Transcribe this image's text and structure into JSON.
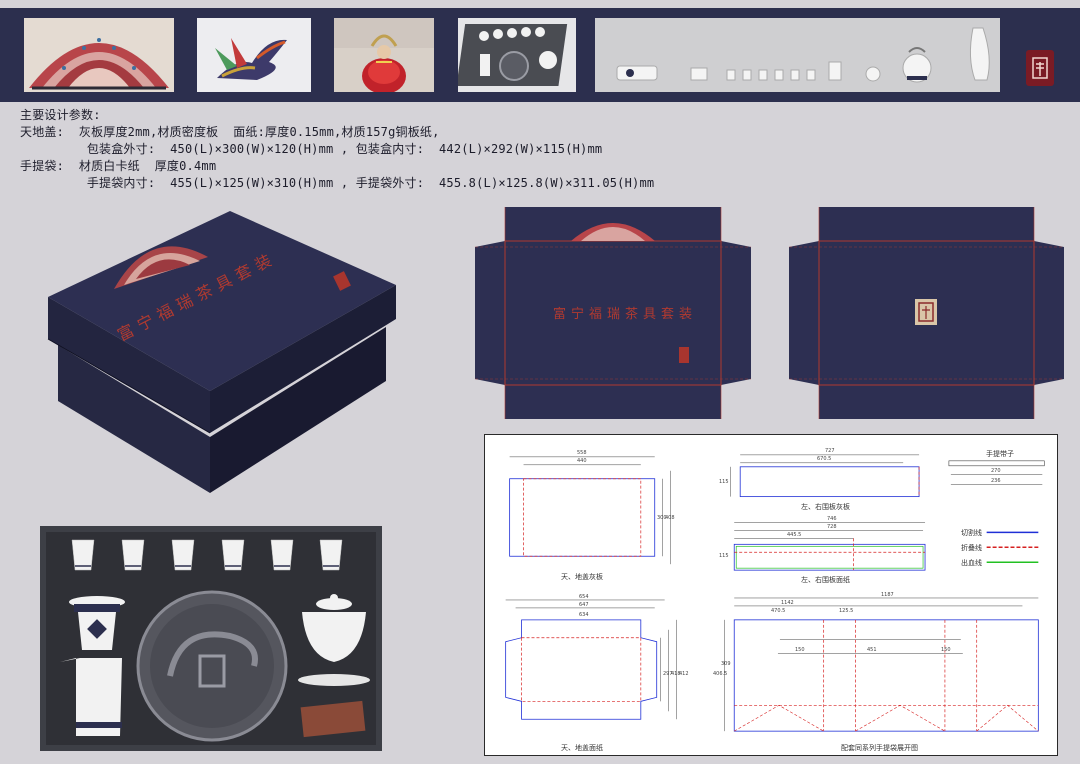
{
  "header_images": [
    {
      "name": "embroidered-fan-pattern"
    },
    {
      "name": "phoenix-sculpture"
    },
    {
      "name": "costumed-figure"
    },
    {
      "name": "tea-set-box"
    }
  ],
  "params": {
    "title": "主要设计参数:",
    "lines": [
      "天地盖:  灰板厚度2mm,材质密度板  面纸:厚度0.15mm,材质157g铜板纸,",
      "         包装盒外寸:  450(L)×300(W)×120(H)mm , 包装盒内寸:  442(L)×292(W)×115(H)mm",
      "手提袋:  材质白卡纸  厚度0.4mm",
      "         手提袋内寸:  455(L)×125(W)×310(H)mm , 手提袋外寸:  455.8(L)×125.8(W)×311.05(H)mm"
    ]
  },
  "box_title": "富宁福瑞茶具套装",
  "tech": {
    "panel1_label": "天、地盖灰板",
    "panel2_label": "左、右围板灰板",
    "panel3_label": "左、右围板面纸",
    "panel4_label": "天、地盖面纸",
    "panel5_label": "配套同系列手提袋展开图",
    "rope_label": "手提带子",
    "legend": [
      {
        "label": "切割线",
        "color": "#1f2fd6"
      },
      {
        "label": "折叠线",
        "color": "#d62020"
      },
      {
        "label": "出血线",
        "color": "#22c022"
      }
    ],
    "dims": {
      "p1_top": "558",
      "p1_inner": "440",
      "p1_side": "300",
      "p1_side2": "408",
      "p2_top": "727",
      "p2_inner": "670.5",
      "p2_side": "115",
      "p3_top": "746",
      "p3_inner": "728",
      "p3_mid": "445.5",
      "p3_side": "115",
      "p4_top": "654",
      "p4_inner": "647",
      "p4_inner2": "634",
      "p4_s1": "297",
      "p4_s2": "418",
      "p4_s3": "412",
      "p5_top": "1187",
      "p5_a": "1142",
      "p5_b": "470.5",
      "p5_c": "125.5",
      "p5_d": "150",
      "p5_e": "451",
      "p5_f": "150",
      "p5_g": "309",
      "p5_h": "406.5",
      "rope_a": "270",
      "rope_b": "236"
    }
  },
  "colors": {
    "navy": "#2c2f4e",
    "box_navy": "#2d2f52",
    "accent_red": "#b03a30"
  }
}
